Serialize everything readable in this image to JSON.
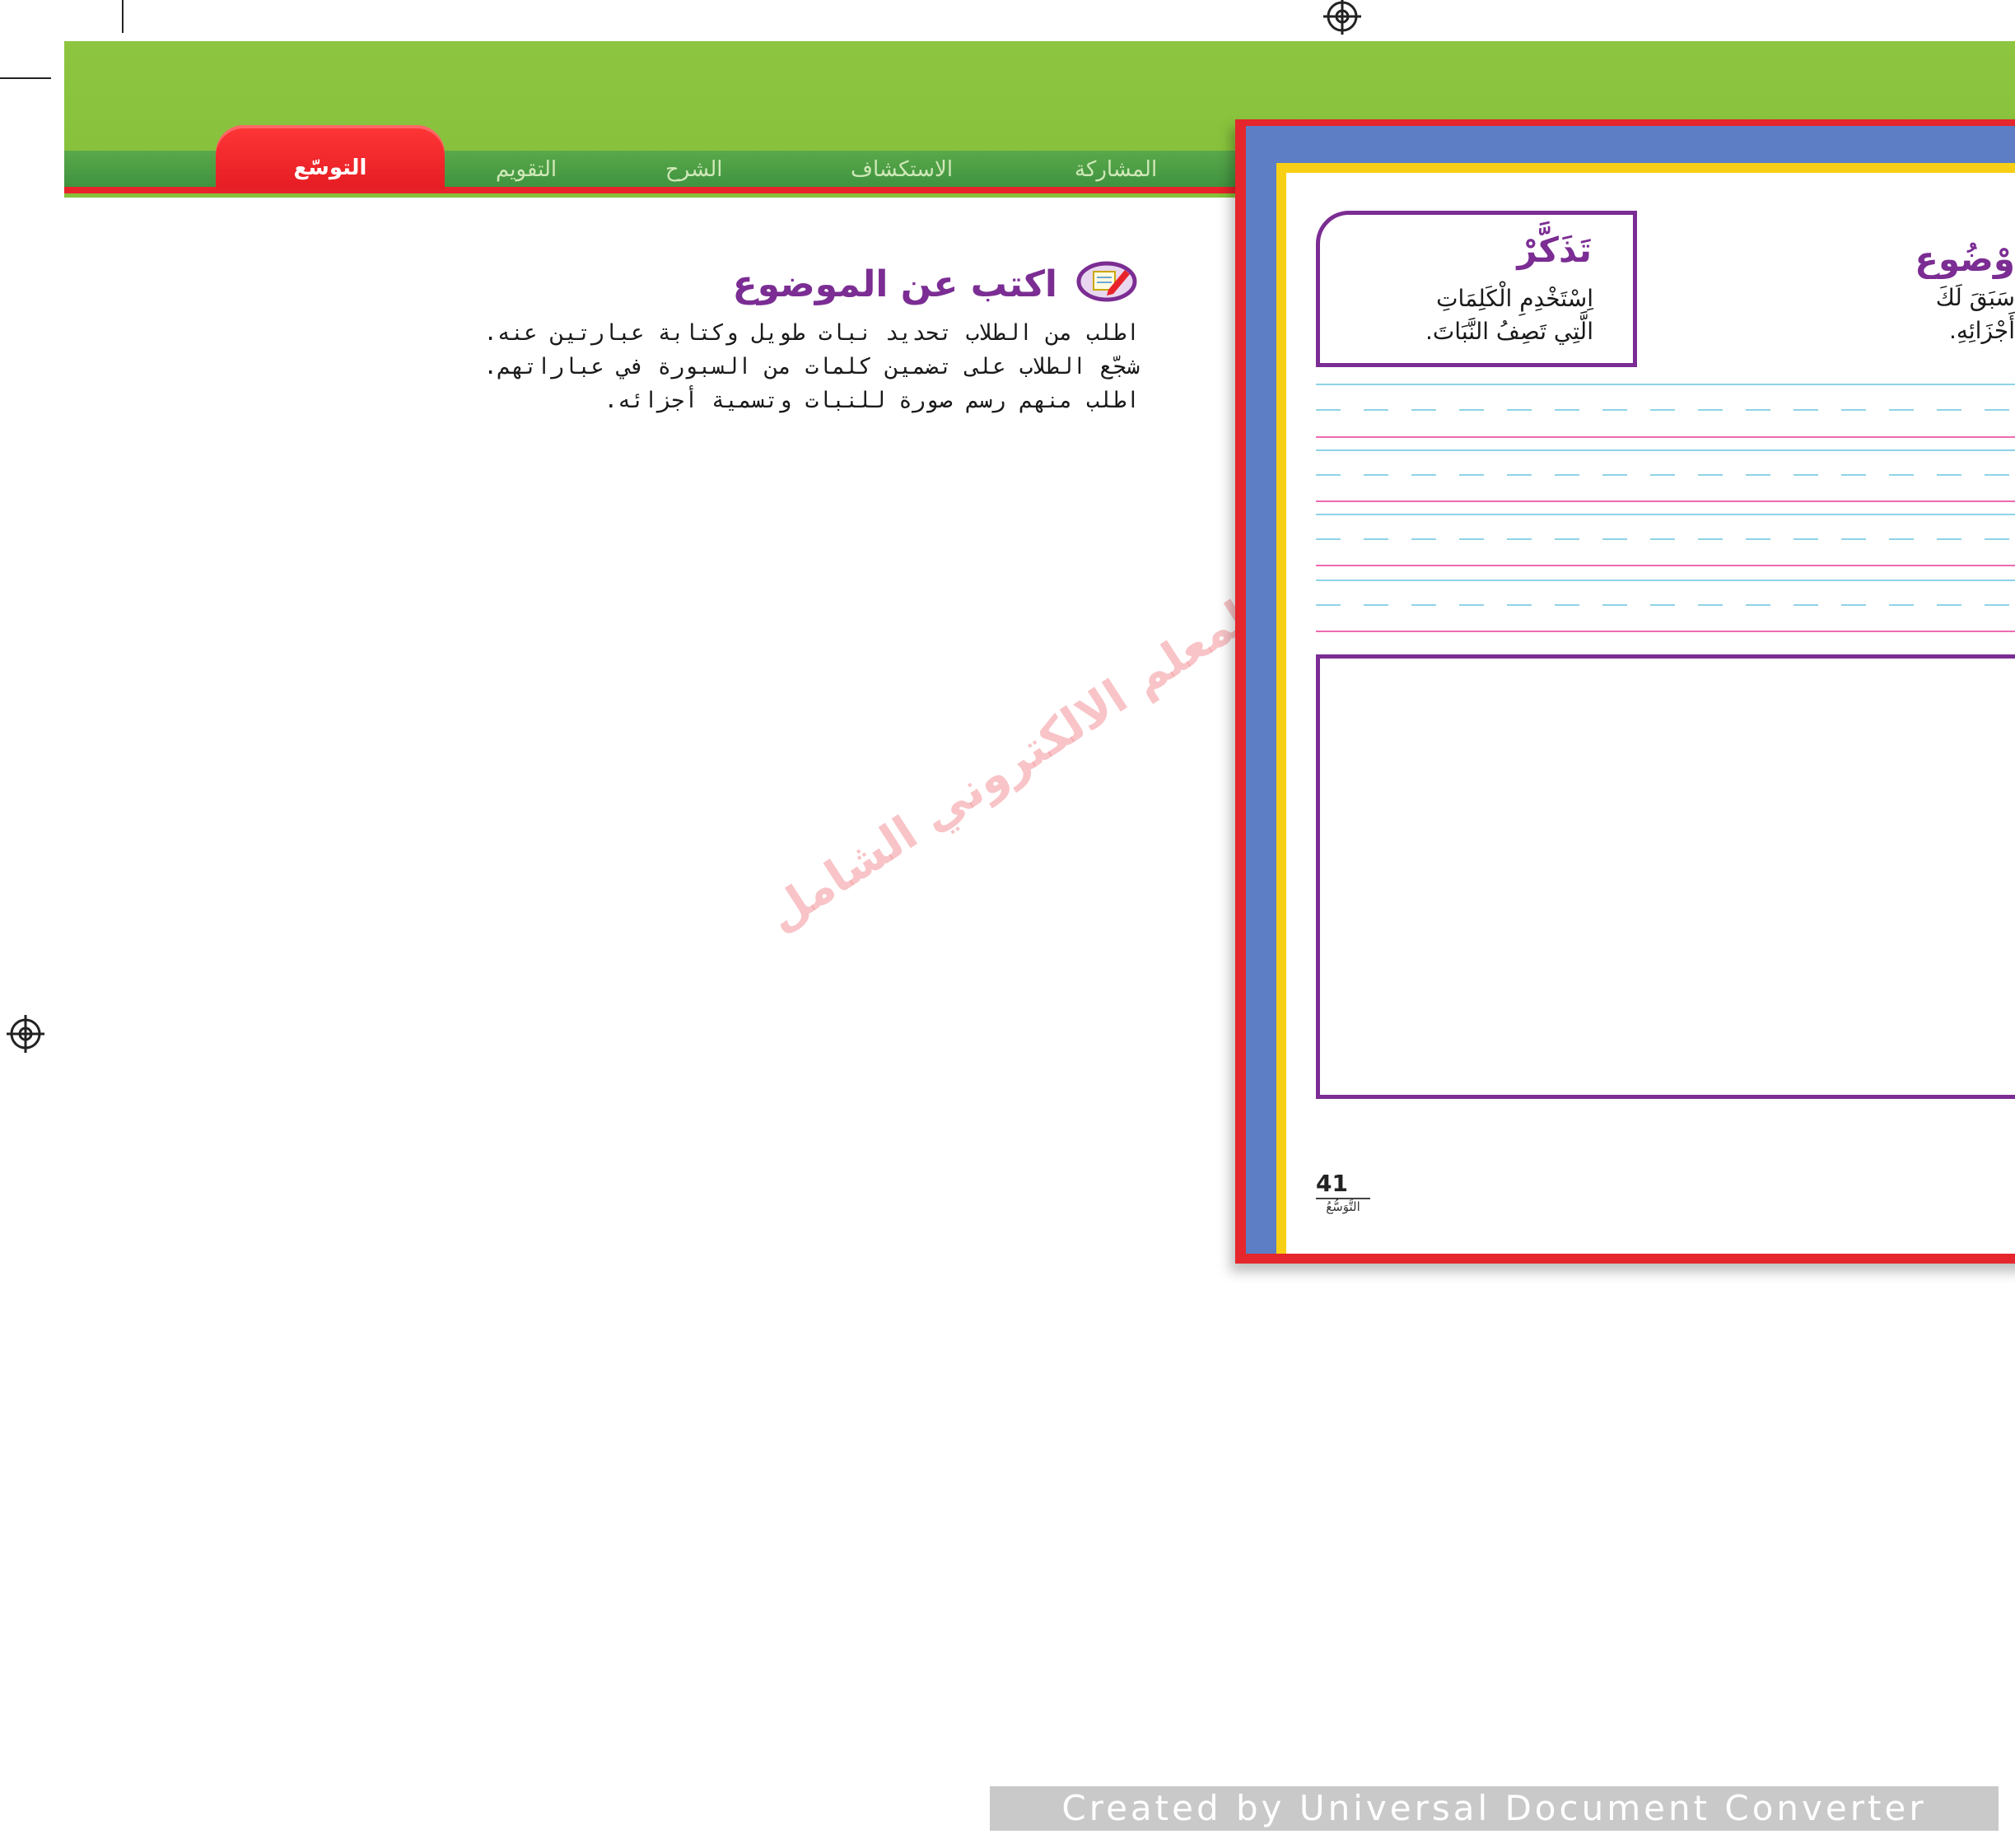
{
  "nav": {
    "tabs": [
      {
        "label": "المشاركة"
      },
      {
        "label": "الاستكشاف"
      },
      {
        "label": "الشرح"
      },
      {
        "label": "التقويم"
      },
      {
        "label": "التوسّع"
      }
    ],
    "active_tab": "التوسّع"
  },
  "lesson": {
    "title": "اكتب عن الموضوع",
    "instructions": [
      "اطلب من الطلاب تحديد نبات طويل وكتابة عبارتين عنه.",
      "شجّع الطلاب على تضمين كلمات من السبورة في عباراتهم.",
      "اطلب منهم رسم صورة للنبات وتسمية أجزائه."
    ]
  },
  "watermark": {
    "text": "المعلم الالكتروني الشامل"
  },
  "workbook_page": {
    "remember": {
      "title": "تَذَكَّرْ",
      "lines": [
        "اِسْتَخْدِمِ الْكَلِمَاتِ",
        "الَّتِي تَصِفُ النَّبَاتَ."
      ]
    },
    "topic_title_partial": "وْضُوع",
    "topic_text_partial": [
      "سَبَقَ لَكَ",
      "أَجْزَائِهِ."
    ],
    "page_number": "41",
    "page_label": "التَّوَسُّعُ"
  },
  "footer": {
    "converter_text": "Created by Universal Document Converter"
  },
  "colors": {
    "header_green": "#8dc540",
    "nav_green": "#3f9340",
    "active_tab_red": "#e51d24",
    "title_purple": "#7b2d93",
    "page_blue": "#5d7ec4",
    "page_yellow": "#f7cf16",
    "guide_blue": "#8fd3e6",
    "guide_pink": "#ee6ab0"
  }
}
